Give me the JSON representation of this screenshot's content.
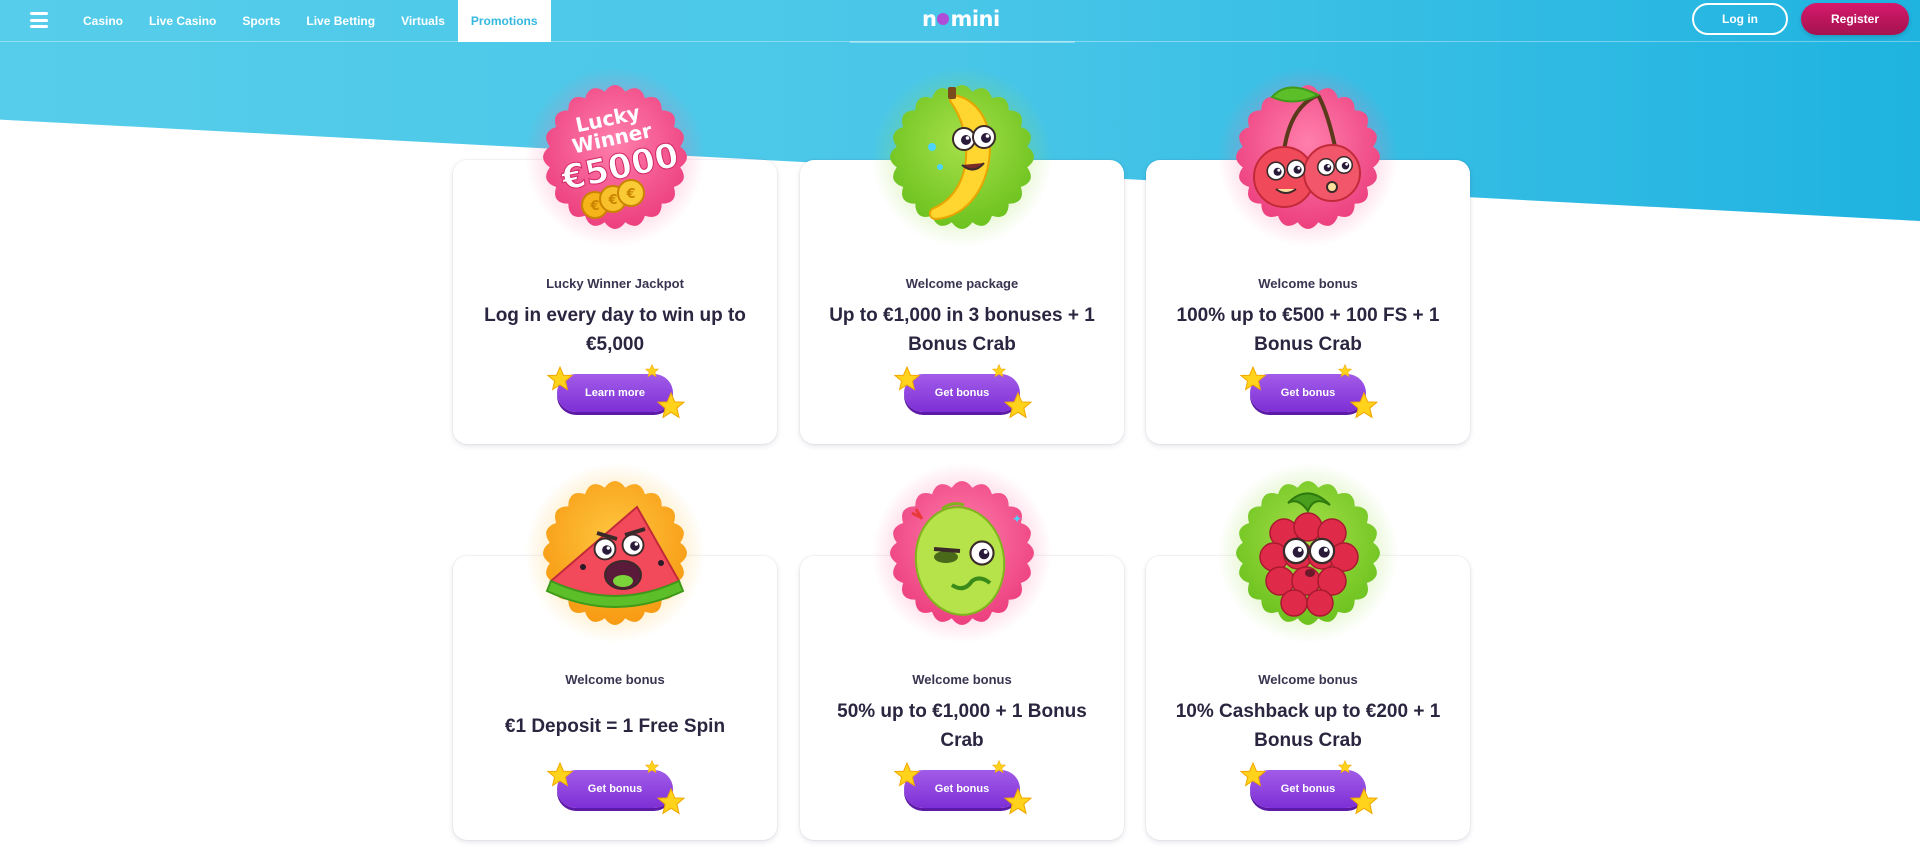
{
  "header": {
    "menu_icon": "hamburger-icon",
    "nav": [
      {
        "label": "Casino",
        "active": false
      },
      {
        "label": "Live Casino",
        "active": false
      },
      {
        "label": "Sports",
        "active": false
      },
      {
        "label": "Live Betting",
        "active": false
      },
      {
        "label": "Virtuals",
        "active": false
      },
      {
        "label": "Promotions",
        "active": true
      }
    ],
    "logo_left": "n",
    "logo_right": "mini",
    "login_label": "Log in",
    "register_label": "Register"
  },
  "colors": {
    "sky": "#49c6e8",
    "accent_purple": "#8a3fe0",
    "register_pink": "#c8175f",
    "badge_pink": "#f0508a",
    "badge_green": "#79c92a",
    "badge_orange": "#f9a520"
  },
  "promos": [
    {
      "label": "Lucky Winner Jackpot",
      "title": "Log in every day to win up to €5,000",
      "button": "Learn more",
      "badge_color": "pink",
      "badge_text_1": "Lucky",
      "badge_text_2": "Winner",
      "badge_text_3": "€5000",
      "icon": "coins-icon"
    },
    {
      "label": "Welcome package",
      "title": "Up to €1,000 in 3 bonuses + 1 Bonus Crab",
      "button": "Get bonus",
      "badge_color": "green",
      "icon": "banana-icon"
    },
    {
      "label": "Welcome bonus",
      "title": "100% up to €500 + 100 FS + 1 Bonus Crab",
      "button": "Get bonus",
      "badge_color": "pink",
      "icon": "cherry-icon"
    },
    {
      "label": "Welcome bonus",
      "title": "€1 Deposit = 1 Free Spin",
      "button": "Get bonus",
      "badge_color": "orange",
      "icon": "watermelon-icon"
    },
    {
      "label": "Welcome bonus",
      "title": "50% up to €1,000 + 1 Bonus Crab",
      "button": "Get bonus",
      "badge_color": "pink",
      "icon": "lemon-icon"
    },
    {
      "label": "Welcome bonus",
      "title": "10% Cashback up to €200 + 1 Bonus Crab",
      "button": "Get bonus",
      "badge_color": "green",
      "icon": "raspberry-icon"
    }
  ]
}
